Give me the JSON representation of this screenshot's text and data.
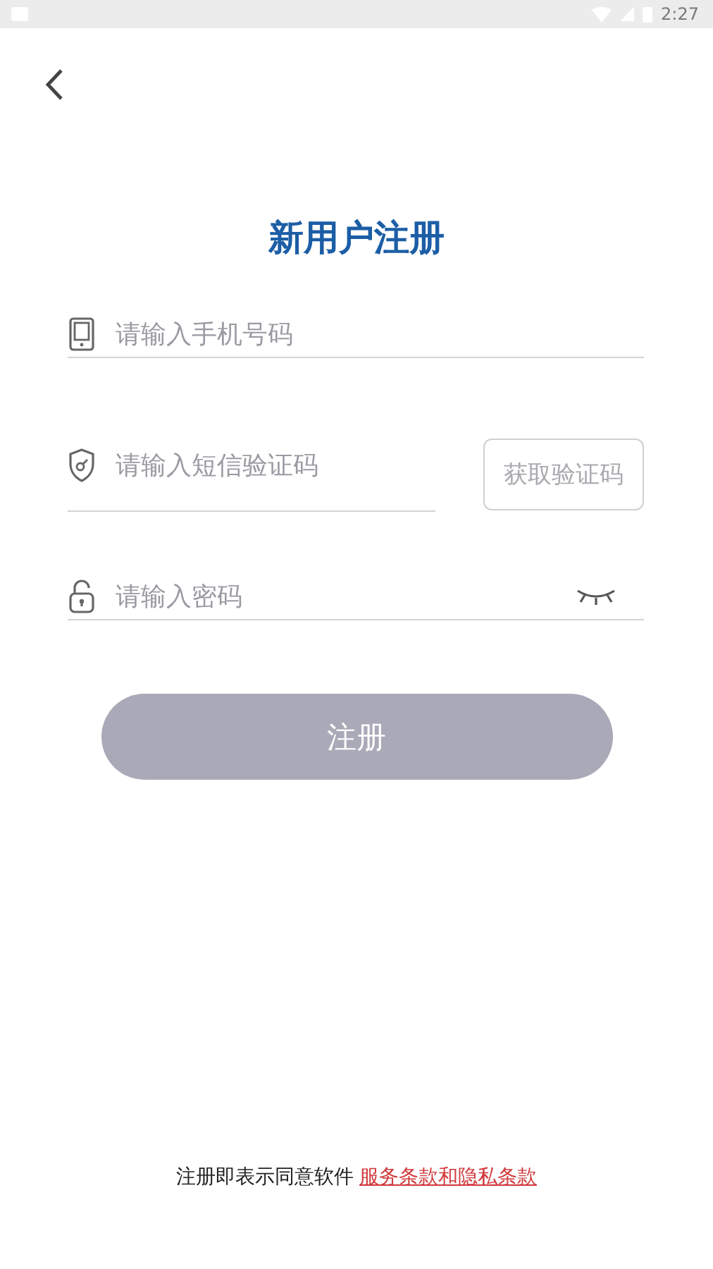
{
  "status_bar": {
    "time": "2:27"
  },
  "title": "新用户注册",
  "fields": [
    {
      "kind": "phone",
      "placeholder": "请输入手机号码"
    },
    {
      "kind": "code",
      "placeholder": "请输入短信验证码",
      "button": "获取验证码"
    },
    {
      "kind": "password",
      "placeholder": "请输入密码"
    }
  ],
  "submit": {
    "label": "注册",
    "disabled": true
  },
  "agreement": {
    "text": "注册即表示同意软件",
    "link": "服务条款和隐私条款"
  }
}
